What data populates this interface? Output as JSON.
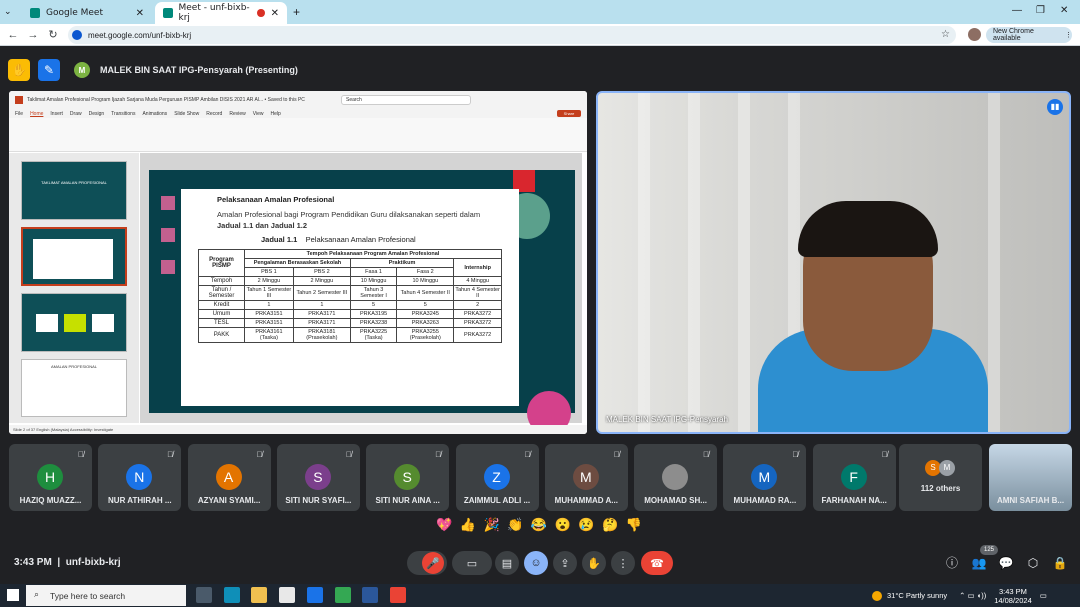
{
  "browser": {
    "tabs": [
      {
        "title": "Google Meet",
        "active": false
      },
      {
        "title": "Meet - unf-bixb-krj",
        "active": true
      }
    ],
    "url": "meet.google.com/unf-bixb-krj",
    "new_chrome": "New Chrome available"
  },
  "meet": {
    "presenter_initial": "M",
    "presenting_label": "MALEK BIN SAAT IPG-Pensyarah (Presenting)",
    "camera_name": "MALEK BIN SAAT IPG-Pensyarah",
    "time": "3:43 PM",
    "meeting_code": "unf-bixb-krj",
    "people_count": "125",
    "participants": [
      {
        "initial": "H",
        "name": "HAZIQ MUAZZ...",
        "color": "#1e8e3e"
      },
      {
        "initial": "N",
        "name": "NUR ATHIRAH ...",
        "color": "#1a73e8"
      },
      {
        "initial": "A",
        "name": "AZYANI SYAMI...",
        "color": "#e37400"
      },
      {
        "initial": "S",
        "name": "SITI NUR SYAFI...",
        "color": "#7b3f8c"
      },
      {
        "initial": "S",
        "name": "SITI NUR AINA ...",
        "color": "#558b2f"
      },
      {
        "initial": "Z",
        "name": "ZAIMMUL ADLI ...",
        "color": "#1a73e8"
      },
      {
        "initial": "M",
        "name": "MUHAMMAD A...",
        "color": "#6d4c41"
      },
      {
        "initial": "",
        "name": "MOHAMAD SH...",
        "color": "#8d8d8d"
      },
      {
        "initial": "M",
        "name": "MUHAMAD RA...",
        "color": "#1565c0"
      },
      {
        "initial": "F",
        "name": "FARHANAH NA...",
        "color": "#00796b"
      }
    ],
    "others_label": "112 others",
    "others_initials": [
      "S",
      "M"
    ],
    "last_tile": "AMNI SAFIAH B...",
    "reactions": [
      "💖",
      "👍",
      "🎉",
      "👏",
      "😂",
      "😮",
      "😢",
      "🤔",
      "👎"
    ]
  },
  "slides": {
    "app_title": "Taklimat Amalan Profesional Program Ijazah Sarjana Muda Perguruan PISMP Ambilan DISIS 2021 AR Al... • Saved to this PC",
    "search": "Search",
    "menu": [
      "File",
      "Home",
      "Insert",
      "Draw",
      "Design",
      "Transitions",
      "Animations",
      "Slide Show",
      "Record",
      "Review",
      "View",
      "Help"
    ],
    "share_btn": "Share",
    "heading": "Pelaksanaan Amalan Profesional",
    "intro": "Amalan Profesional bagi Program Pendidikan Guru dilaksanakan seperti dalam",
    "intro_bold": "Jadual 1.1 dan Jadual 1.2",
    "table_caption_no": "Jadual 1.1",
    "table_caption": "Pelaksanaan Amalan Profesional",
    "table": {
      "top_header": "Tempoh Pelaksanaan Program Amalan Profesional",
      "col_program": "Program PISMP",
      "col_pbs": "Pengalaman Berasaskan Sekolah",
      "col_praktikum": "Praktikum",
      "col_internship": "Internship",
      "sub": [
        "PBS 1",
        "PBS 2",
        "Fasa 1",
        "Fasa 2",
        ""
      ],
      "rows": [
        {
          "label": "Tempoh",
          "cells": [
            "2 Minggu",
            "2 Minggu",
            "10 Minggu",
            "10 Minggu",
            "4 Minggu"
          ]
        },
        {
          "label": "Tahun / Semester",
          "cells": [
            "Tahun 1 Semester III",
            "Tahun 2 Semester III",
            "Tahun 3 Semester I",
            "Tahun 4 Semester II",
            "Tahun 4 Semester II"
          ]
        },
        {
          "label": "Kredit",
          "cells": [
            "1",
            "1",
            "5",
            "5",
            "2"
          ]
        },
        {
          "label": "Umum",
          "cells": [
            "PRKA3151",
            "PRKA3171",
            "PRKA3195",
            "PRKA3245",
            "PRKA3272"
          ]
        },
        {
          "label": "TESL",
          "cells": [
            "PRKA3151",
            "PRKA3171",
            "PRKA3238",
            "PRKA3263",
            "PRKA3272"
          ]
        },
        {
          "label": "PAKK",
          "cells": [
            "PRKA3161 (Taska)",
            "PRKA3181 (Prasekolah)",
            "PRKA3225 (Taska)",
            "PRKA3255 (Prasekolah)",
            "PRKA3272"
          ]
        }
      ]
    },
    "thumb_title": "TAKLIMAT AMALAN PROFESIONAL",
    "thumb4_title": "AMALAN PROFESIONAL",
    "status": "Slide 2 of 37    English (Malaysia)    Accessibility: Investigate"
  },
  "taskbar": {
    "search_placeholder": "Type here to search",
    "weather": "31°C  Partly sunny",
    "clock_time": "3:43 PM",
    "clock_date": "14/08/2024"
  }
}
